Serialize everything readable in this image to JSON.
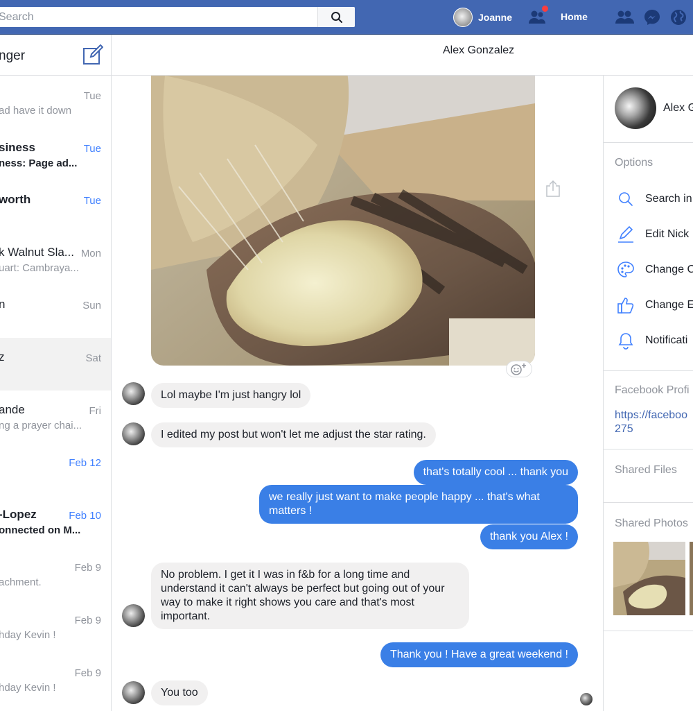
{
  "topbar": {
    "search_placeholder": "Search",
    "user_name": "Joanne",
    "home_label": "Home"
  },
  "sidebar": {
    "title": "nger",
    "conversations": [
      {
        "name": "",
        "date": "Tue",
        "snippet": "ad have it down",
        "unread": false,
        "active": false
      },
      {
        "name": "siness",
        "date": "Tue",
        "snippet": "ness: Page ad...",
        "unread": true,
        "active": false
      },
      {
        "name": "worth",
        "date": "Tue",
        "snippet": "",
        "unread": true,
        "active": false
      },
      {
        "name": "k Walnut Sla...",
        "date": "Mon",
        "snippet": "uart: Cambraya...",
        "unread": false,
        "active": false
      },
      {
        "name": "n",
        "date": "Sun",
        "snippet": "",
        "unread": false,
        "active": false
      },
      {
        "name": "z",
        "date": "Sat",
        "snippet": "",
        "unread": false,
        "active": true
      },
      {
        "name": "ande",
        "date": "Fri",
        "snippet": "ng a prayer chai...",
        "unread": false,
        "active": false
      },
      {
        "name": "",
        "date": "Feb 12",
        "snippet": "",
        "unread": true,
        "active": false
      },
      {
        "name": "-Lopez",
        "date": "Feb 10",
        "snippet": "onnected on M...",
        "unread": true,
        "active": false
      },
      {
        "name": "",
        "date": "Feb 9",
        "snippet": "achment.",
        "unread": false,
        "active": false
      },
      {
        "name": "",
        "date": "Feb 9",
        "snippet": "hday Kevin !",
        "unread": false,
        "active": false
      },
      {
        "name": "",
        "date": "Feb 9",
        "snippet": "hday Kevin !",
        "unread": false,
        "active": false
      }
    ]
  },
  "chat": {
    "contact_name": "Alex Gonzalez",
    "messages": [
      {
        "text": "Lol maybe I'm just hangry lol",
        "from": "in"
      },
      {
        "text": "I edited my post but won't let me adjust the star rating.",
        "from": "in"
      },
      {
        "text": "that's totally cool ... thank you",
        "from": "out"
      },
      {
        "text": "we really just want to make people happy ...  that's what matters !",
        "from": "out"
      },
      {
        "text": "thank you Alex !",
        "from": "out"
      },
      {
        "text": "No problem. I get it I was in f&b for a long time and understand it can't always be perfect but going out of your way to make it right shows you care and that's most important.",
        "from": "in"
      },
      {
        "text": "Thank you ! Have a great weekend !",
        "from": "out"
      },
      {
        "text": "You too",
        "from": "in"
      }
    ]
  },
  "info_panel": {
    "contact_name": "Alex G",
    "options_title": "Options",
    "options": [
      {
        "icon": "search-icon",
        "label": "Search in"
      },
      {
        "icon": "pencil-icon",
        "label": "Edit Nick"
      },
      {
        "icon": "palette-icon",
        "label": "Change C"
      },
      {
        "icon": "thumbs-up-icon",
        "label": "Change E"
      },
      {
        "icon": "bell-icon",
        "label": "Notificati"
      }
    ],
    "profile_title": "Facebook Profi",
    "profile_link_line1": "https://faceboo",
    "profile_link_line2": "275",
    "shared_files_title": "Shared Files",
    "shared_photos_title": "Shared Photos"
  },
  "colors": {
    "brand_blue": "#4267b2",
    "outgoing_bubble": "#3a7fe6",
    "incoming_bubble": "#f1f0f0",
    "unread_date": "#4080ff",
    "notification": "#fa3e3e"
  }
}
